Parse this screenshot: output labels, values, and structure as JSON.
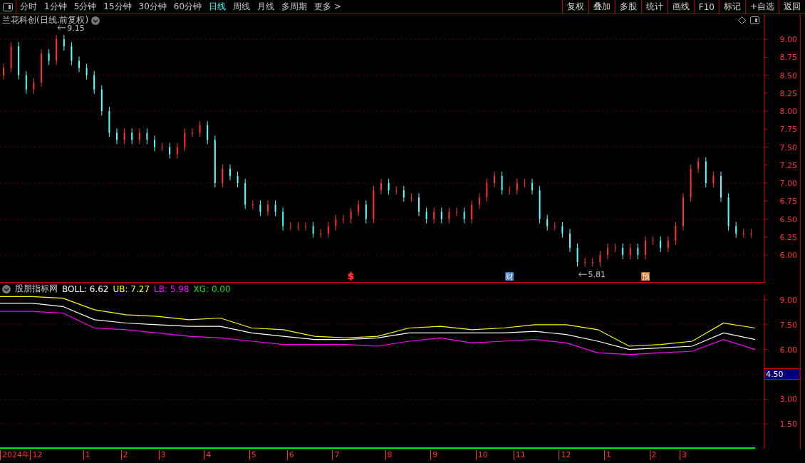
{
  "toolbar": {
    "periods": [
      {
        "label": "分时",
        "selected": false
      },
      {
        "label": "1分钟",
        "selected": false
      },
      {
        "label": "5分钟",
        "selected": false
      },
      {
        "label": "15分钟",
        "selected": false
      },
      {
        "label": "30分钟",
        "selected": false
      },
      {
        "label": "60分钟",
        "selected": false
      },
      {
        "label": "日线",
        "selected": true
      },
      {
        "label": "周线",
        "selected": false
      },
      {
        "label": "月线",
        "selected": false
      },
      {
        "label": "多周期",
        "selected": false
      },
      {
        "label": "更多 >",
        "selected": false
      }
    ],
    "buttons": [
      "复权",
      "叠加",
      "多股",
      "统计",
      "画线",
      "F10",
      "标记",
      "+自选",
      "返回"
    ]
  },
  "price_panel": {
    "title": "兰花科创(日线.前复权)",
    "high_label": "9.15",
    "low_label": "5.81",
    "price_axis": [
      "9.00",
      "8.75",
      "8.50",
      "8.25",
      "8.00",
      "7.75",
      "7.50",
      "7.25",
      "7.00",
      "6.75",
      "6.50",
      "6.25",
      "6.00"
    ],
    "event_markers": [
      {
        "text": "$",
        "kind": "plain",
        "color": "#ff3232"
      },
      {
        "text": "财",
        "kind": "boxed",
        "color": "#3c78c8"
      },
      {
        "text": "预",
        "kind": "boxed",
        "color": "#d26414"
      }
    ]
  },
  "indicator_panel": {
    "name": "股朋指标网",
    "legend": [
      {
        "value": ": 6.62"
      },
      {
        "value": ": 7.27"
      },
      {
        "value": ": 5.98"
      },
      {
        "value": ": 0.00"
      }
    ],
    "cursor_value": "4.50",
    "chart_data": {
      "type": "line",
      "grid": true,
      "ylim": [
        0,
        9.3
      ],
      "yticks": [
        {
          "value": 1.5,
          "label": "1.50"
        },
        {
          "value": 3,
          "label": "3.00"
        },
        {
          "value": 6,
          "label": "6.00"
        },
        {
          "value": 7.5,
          "label": "7.50"
        },
        {
          "value": 9,
          "label": "9.00"
        }
      ],
      "series": [
        {
          "name": "BOLL",
          "color": "#ffffff",
          "values": [
            8.8,
            8.8,
            8.6,
            7.8,
            7.6,
            7.5,
            7.4,
            7.4,
            7.0,
            6.8,
            6.6,
            6.6,
            6.7,
            7.0,
            7.0,
            7.0,
            7.0,
            7.1,
            6.9,
            6.5,
            6.0,
            6.1,
            6.2,
            7.0,
            6.6
          ]
        },
        {
          "name": "UB",
          "color": "#ffff00",
          "values": [
            9.2,
            9.2,
            9.1,
            8.4,
            8.1,
            8.0,
            7.8,
            7.9,
            7.3,
            7.2,
            6.8,
            6.7,
            6.8,
            7.3,
            7.4,
            7.2,
            7.3,
            7.5,
            7.5,
            7.2,
            6.2,
            6.3,
            6.5,
            7.6,
            7.3
          ]
        },
        {
          "name": "LB",
          "color": "#ff00ff",
          "values": [
            8.3,
            8.3,
            8.2,
            7.3,
            7.2,
            7.0,
            6.8,
            6.7,
            6.5,
            6.3,
            6.3,
            6.3,
            6.2,
            6.5,
            6.7,
            6.4,
            6.5,
            6.6,
            6.4,
            5.8,
            5.7,
            5.8,
            5.9,
            6.6,
            6.0
          ]
        },
        {
          "name": "XG",
          "color": "#00e600",
          "values": [
            0,
            0,
            0,
            0,
            0,
            0,
            0,
            0,
            0,
            0,
            0,
            0,
            0,
            0,
            0,
            0,
            0,
            0,
            0,
            0,
            0,
            0,
            0,
            0,
            0
          ]
        }
      ]
    }
  },
  "date_axis": [
    "2024年",
    "12",
    "1",
    "2",
    "3",
    "4",
    "5",
    "6",
    "7",
    "8",
    "9",
    "10",
    "11",
    "12",
    "1",
    "2",
    "3"
  ]
}
